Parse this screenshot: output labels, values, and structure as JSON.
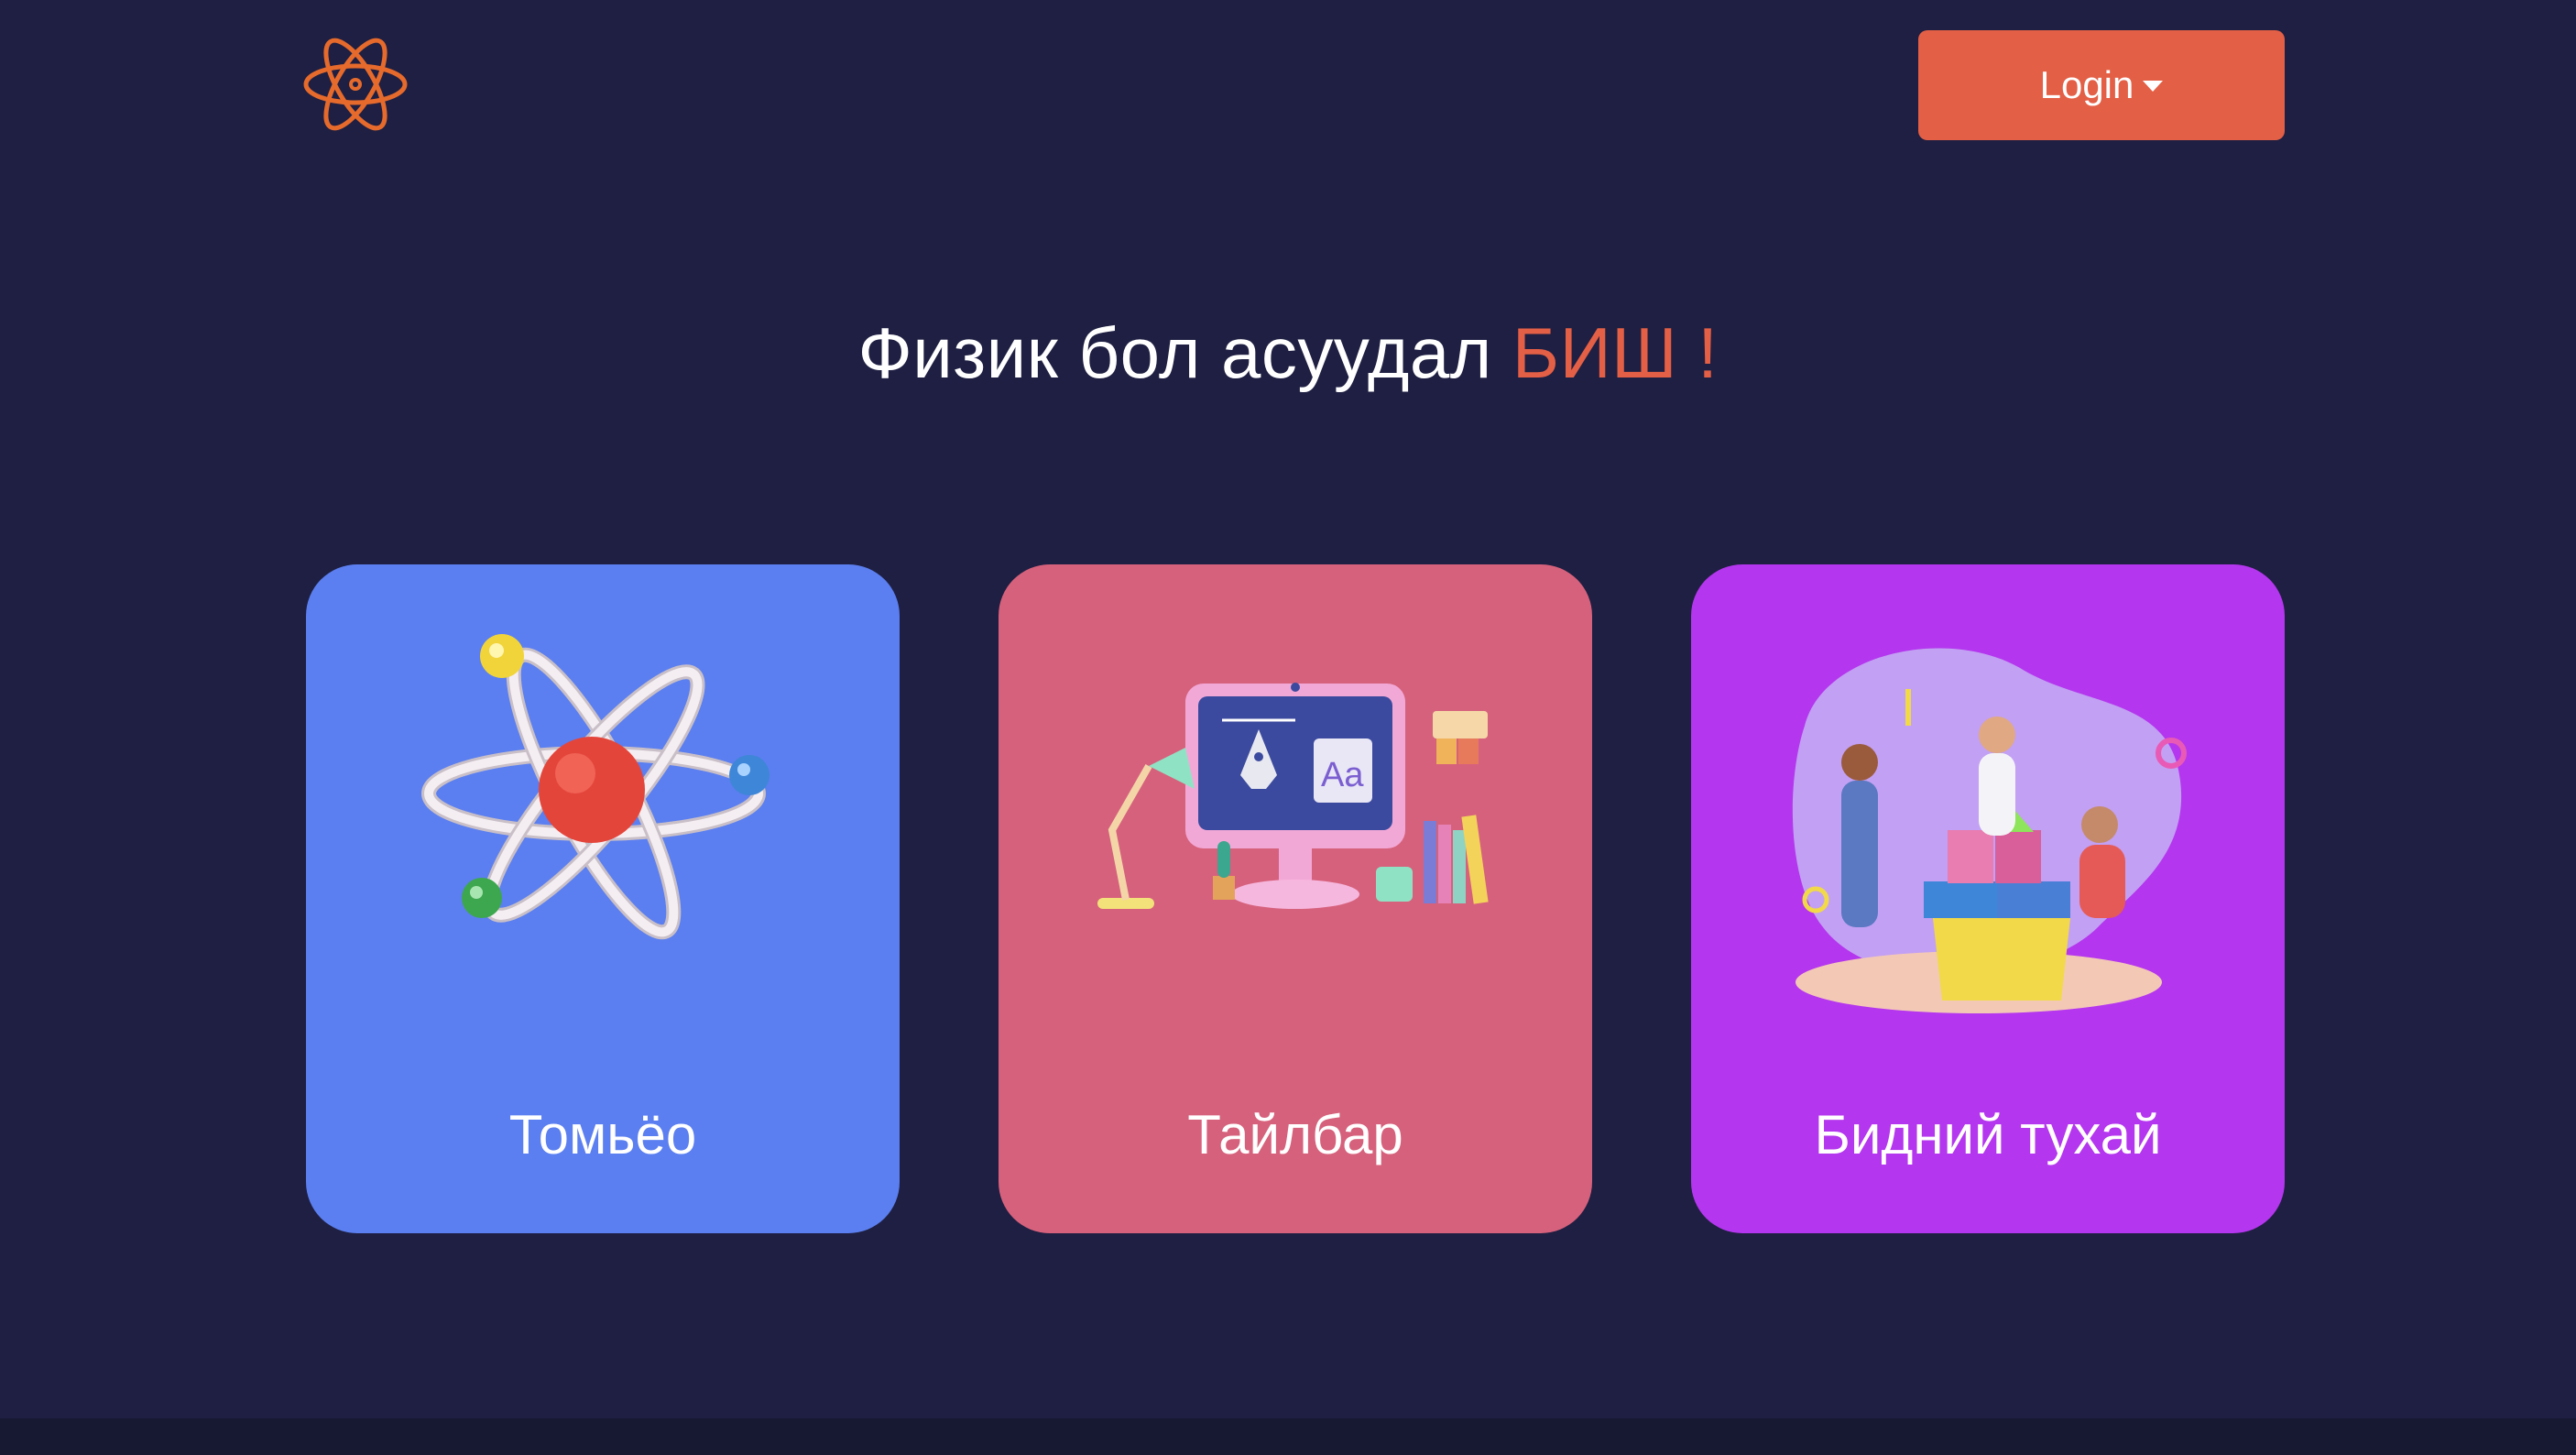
{
  "header": {
    "logo_icon": "atom-icon",
    "login_label": "Login"
  },
  "hero": {
    "headline_main": "Физик бол асуудал",
    "headline_accent": "БИШ !"
  },
  "cards": [
    {
      "label": "Томьёо",
      "icon": "atom-illustration",
      "color": "#5b7ff0"
    },
    {
      "label": "Тайлбар",
      "icon": "design-workspace-illustration",
      "color": "#d6617c"
    },
    {
      "label": "Бидний тухай",
      "icon": "team-building-blocks-illustration",
      "color": "#b436ee"
    }
  ],
  "colors": {
    "background": "#1e1f42",
    "accent": "#e35f45",
    "footer": "#171832"
  }
}
